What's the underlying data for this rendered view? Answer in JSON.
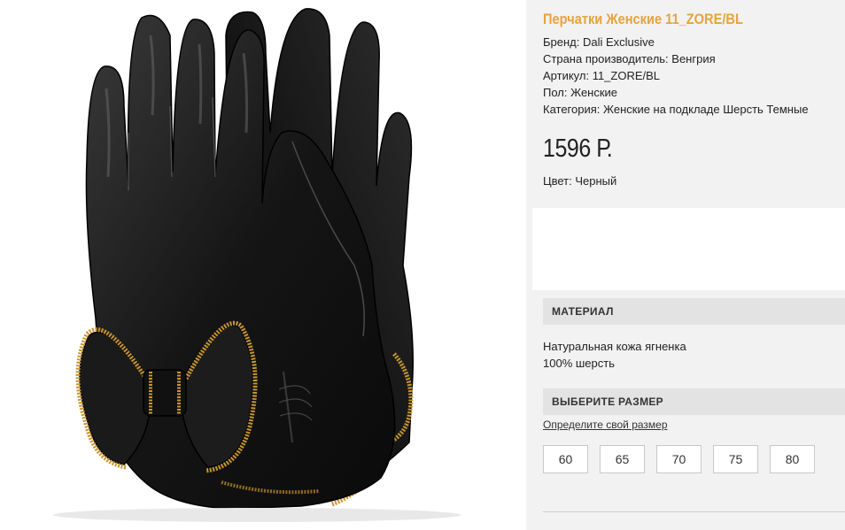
{
  "product": {
    "title": "Перчатки Женские 11_ZORE/BL",
    "brand": "Бренд: Dali Exclusive",
    "country": "Страна производитель: Венгрия",
    "article": "Артикул: 11_ZORE/BL",
    "gender": "Пол: Женские",
    "category": "Категория: Женские на подкладе Шерсть Темные",
    "price": "1596 Р.",
    "color": "Цвет: Черный",
    "image_icon": "leather-gloves-with-bow-image"
  },
  "material": {
    "heading": "МАТЕРИАЛ",
    "line1": "Натуральная кожа ягненка",
    "line2": "100% шерсть"
  },
  "size": {
    "heading": "ВЫБЕРИТЕ РАЗМЕР",
    "link": "Определите свой размер",
    "options": [
      "60",
      "65",
      "70",
      "75",
      "80"
    ]
  },
  "colors": {
    "accent": "#e8a33c",
    "panel": "#f2f2f2",
    "section": "#e3e3e3"
  }
}
